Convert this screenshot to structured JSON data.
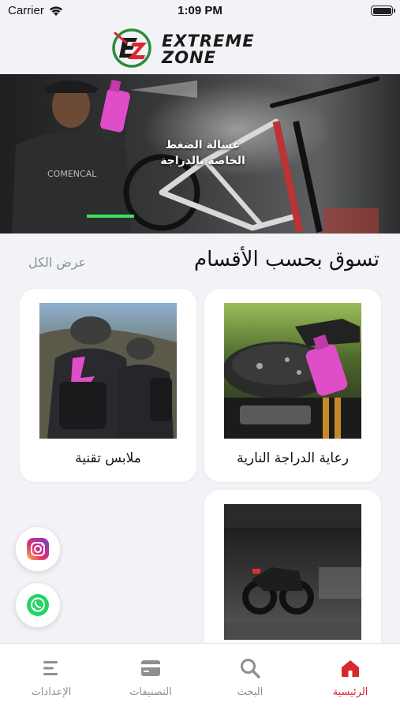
{
  "status_bar": {
    "carrier": "Carrier",
    "time": "1:09 PM"
  },
  "brand": {
    "line1": "EXTREME",
    "line2": "ZONE",
    "accent_color": "#d9272e",
    "ring_color": "#2e8b3e"
  },
  "hero": {
    "text": "غسالة الضغط الخاصة بالدراجة"
  },
  "categories_section": {
    "title": "تسوق بحسب الأقسام",
    "view_all": "عرض الكل",
    "items": [
      {
        "label": "رعاية الدراجة النارية",
        "image": "motorcycle-cleaner-photo"
      },
      {
        "label": "ملابس تقنية",
        "image": "cyclists-apparel-photo"
      },
      {
        "label": "",
        "image": "motorcycle-garage-photo"
      }
    ]
  },
  "social": [
    {
      "name": "instagram",
      "icon": "instagram-icon"
    },
    {
      "name": "whatsapp",
      "icon": "whatsapp-icon"
    }
  ],
  "tabbar": {
    "items": [
      {
        "label": "الرئيسية",
        "icon": "home-icon",
        "active": true
      },
      {
        "label": "البحث",
        "icon": "search-icon",
        "active": false
      },
      {
        "label": "التصنيفات",
        "icon": "categories-icon",
        "active": false
      },
      {
        "label": "الإعدادات",
        "icon": "settings-list-icon",
        "active": false
      }
    ]
  },
  "colors": {
    "active": "#d9272e",
    "inactive": "#8e8e93",
    "background": "#f2f3f6"
  }
}
